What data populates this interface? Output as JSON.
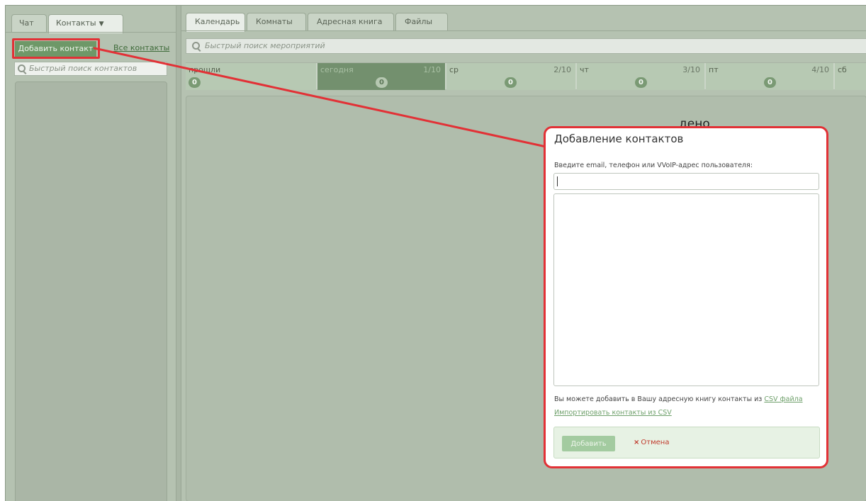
{
  "sidebar": {
    "tabs": [
      {
        "label": "Чат"
      },
      {
        "label": "Контакты"
      }
    ],
    "add_contact_label": "Добавить контакт",
    "all_contacts_label": "Все контакты",
    "search_placeholder": "Быстрый поиск контактов"
  },
  "main": {
    "tabs": [
      {
        "label": "Календарь"
      },
      {
        "label": "Комнаты"
      },
      {
        "label": "Адресная книга"
      },
      {
        "label": "Файлы"
      }
    ],
    "event_search_placeholder": "Быстрый поиск мероприятий",
    "days": [
      {
        "name": "прошли",
        "date": "",
        "count": "0"
      },
      {
        "name": "сегодня",
        "date": "1/10",
        "count": "0"
      },
      {
        "name": "ср",
        "date": "2/10",
        "count": "0"
      },
      {
        "name": "чт",
        "date": "3/10",
        "count": "0"
      },
      {
        "name": "пт",
        "date": "4/10",
        "count": "0"
      },
      {
        "name": "сб",
        "date": "",
        "count": ""
      }
    ],
    "no_events_partial": "дено"
  },
  "dialog": {
    "title": "Добавление контактов",
    "prompt": "Введите email, телефон или VVoIP-адрес пользователя:",
    "email_value": "",
    "csv_text": "Вы можете добавить в Вашу адресную книгу контакты из",
    "csv_link": "CSV файла",
    "import_link": "Импортировать контакты из CSV",
    "confirm_label": "Добавить",
    "cancel_x": "×",
    "cancel_label": "Отмена"
  },
  "colors": {
    "accent_green": "#6e9868",
    "annotation_red": "#e23136",
    "cancel_red": "#c0392b",
    "link_green": "#6fa06b"
  }
}
